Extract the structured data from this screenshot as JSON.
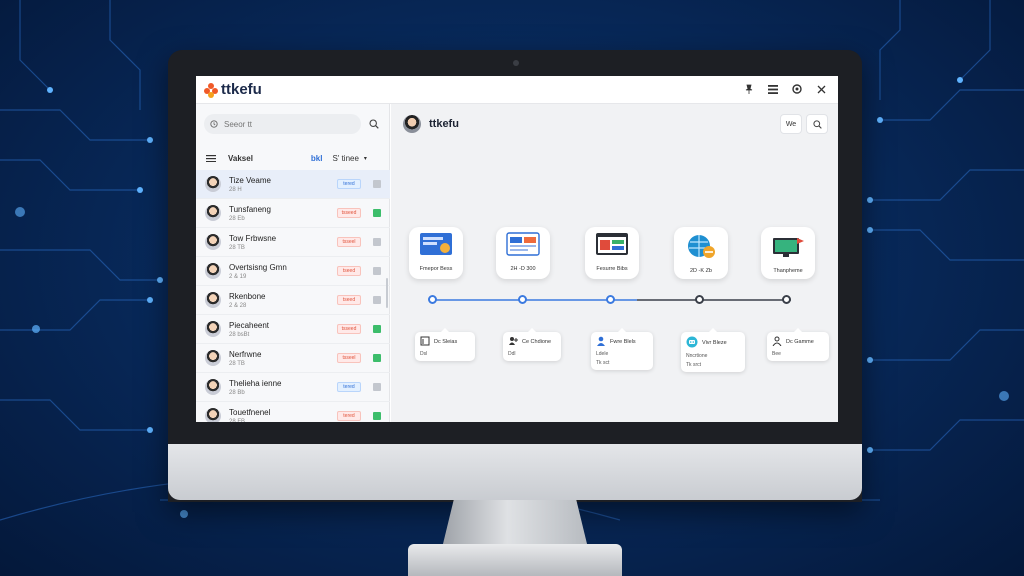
{
  "app": {
    "logo_text": "ttkefu",
    "window_controls": [
      "pin-icon",
      "menu-icon",
      "settings-icon",
      "close-icon"
    ]
  },
  "sidebar": {
    "search_placeholder": "Seeor tt",
    "list_title": "Vaksel",
    "filter_tag": "bkl",
    "sort_label": "S' tinee",
    "conversations": [
      {
        "name": "Tize Veame",
        "sub": "28 H",
        "badge": "tered",
        "badge_color": "blue",
        "icon": "grey",
        "active": true
      },
      {
        "name": "Tunsfaneng",
        "sub": "28 Eb",
        "badge": "tsseed",
        "badge_color": "red",
        "icon": "green",
        "active": false
      },
      {
        "name": "Tow Frbwsne",
        "sub": "28 TB",
        "badge": "tsseel",
        "badge_color": "red",
        "icon": "grey",
        "active": false
      },
      {
        "name": "Overtsisng Gmn",
        "sub": "2 & 19",
        "badge": "tseed",
        "badge_color": "red",
        "icon": "grey",
        "active": false
      },
      {
        "name": "Rkenbone",
        "sub": "2 & 28",
        "badge": "tseed",
        "badge_color": "red",
        "icon": "grey",
        "active": false
      },
      {
        "name": "Piecaheent",
        "sub": "28 bsBt",
        "badge": "tsseed",
        "badge_color": "red",
        "icon": "green",
        "active": false
      },
      {
        "name": "Nerfrwne",
        "sub": "28 TB",
        "badge": "tsseel",
        "badge_color": "red",
        "icon": "green",
        "active": false
      },
      {
        "name": "Thelieha ienne",
        "sub": "28 Bb",
        "badge": "tered",
        "badge_color": "blue",
        "icon": "grey",
        "active": false
      },
      {
        "name": "Touetfnenel",
        "sub": "28 FB",
        "badge": "tered",
        "badge_color": "red",
        "icon": "green",
        "active": false
      }
    ]
  },
  "chat": {
    "title": "ttkefu",
    "header_buttons": [
      "We",
      "search-icon"
    ],
    "nodes": [
      {
        "label": "Fmepor Bess",
        "icon": "chat-window-icon",
        "dot": "blue"
      },
      {
        "label": "2H -D 300",
        "icon": "dashboard-icon",
        "dot": "blue"
      },
      {
        "label": "Fesurre Bibs",
        "icon": "browser-icon",
        "dot": "blue"
      },
      {
        "label": "2D -K Zb",
        "icon": "globe-handshake-icon",
        "dot": "dark"
      },
      {
        "label": "Thanpheme",
        "icon": "monitor-flag-icon",
        "dot": "dark"
      }
    ],
    "steps": [
      {
        "icon": "document-icon",
        "line1": "Dc Sleias",
        "line2": "Dsl",
        "line3": ""
      },
      {
        "icon": "user-plus-icon",
        "line1": "Ce Chdione",
        "line2": "Ddl",
        "line3": ""
      },
      {
        "icon": "user-icon",
        "line1": "Fwre Blels",
        "line2": "Ldele",
        "line3": "Tk sct"
      },
      {
        "icon": "robot-icon",
        "line1": "Vivr Bleze",
        "line2": "Nncrtione",
        "line3": "Tk srct"
      },
      {
        "icon": "user-outline-icon",
        "line1": "Dc Gamme",
        "line2": "Bee",
        "line3": ""
      }
    ],
    "scroll_top_label": "↑"
  }
}
